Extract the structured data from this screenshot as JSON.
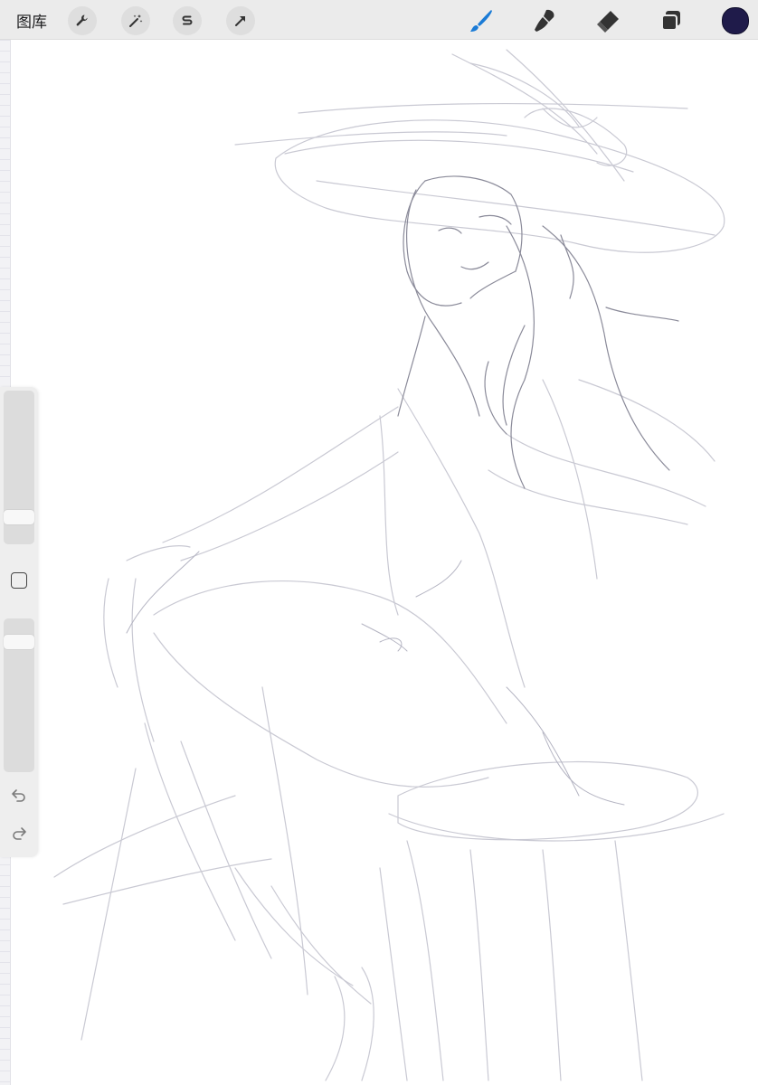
{
  "topbar": {
    "gallery_label": "图库",
    "left_tools": [
      {
        "icon": "wrench-icon",
        "name": "actions"
      },
      {
        "icon": "magic-wand-icon",
        "name": "adjustments"
      },
      {
        "icon": "selection-s-icon",
        "name": "selection"
      },
      {
        "icon": "transform-arrow-icon",
        "name": "transform"
      }
    ],
    "right_tools": [
      {
        "icon": "brush-icon",
        "name": "paint",
        "active": true
      },
      {
        "icon": "smudge-icon",
        "name": "smudge"
      },
      {
        "icon": "eraser-icon",
        "name": "erase"
      },
      {
        "icon": "layers-icon",
        "name": "layers"
      }
    ],
    "current_color": "#1f1b4a",
    "accent_color": "#1a7bd6"
  },
  "sidebar": {
    "brush_size_level": 0.14,
    "opacity_level": 0.88,
    "modify_icon": "square-modify-icon",
    "undo_icon": "undo-icon",
    "redo_icon": "redo-icon"
  }
}
